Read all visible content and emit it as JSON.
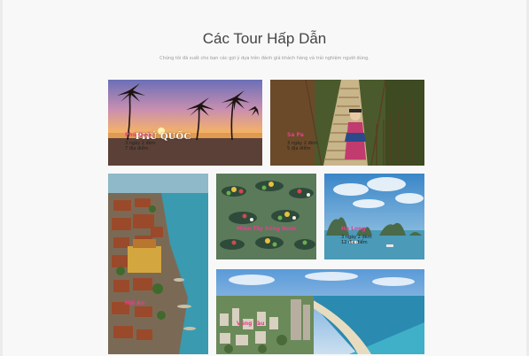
{
  "section": {
    "title": "Các Tour Hấp Dẫn",
    "subtitle": "Chúng tôi đã xuất cho bạn các gợi ý dựa trên đánh giá khách hàng và trải nghiệm người dùng."
  },
  "tours": [
    {
      "name": "Phú Quốc",
      "logo_text": "PHÚ QUỐC",
      "line1": "3 ngày 2 đêm",
      "line2": "7 địa điểm"
    },
    {
      "name": "Sa Pa",
      "line1": "3 ngày 2 đêm",
      "line2": "5 địa điểm"
    },
    {
      "name": "Hội An"
    },
    {
      "name": "Miền Tây Sông Nước"
    },
    {
      "name": "Hạ Long",
      "line1": "3 ngày 2 đêm",
      "line2": "12 địa điểm"
    },
    {
      "name": "Vũng Tàu"
    }
  ],
  "colors": {
    "accent": "#e83e8c",
    "background": "#f8f8f8"
  }
}
